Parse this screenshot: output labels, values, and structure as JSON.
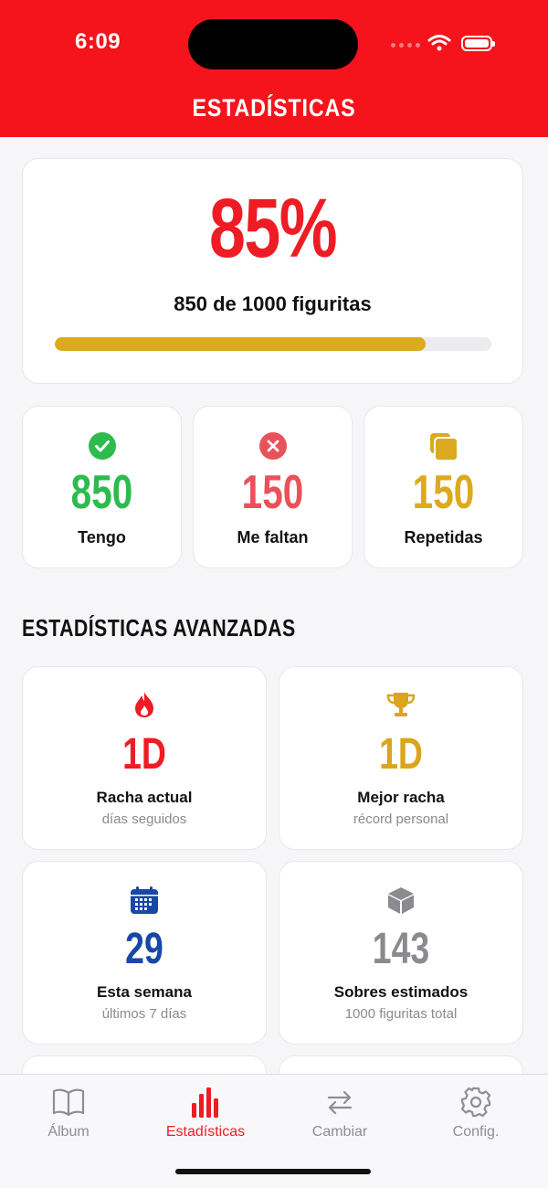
{
  "status_bar": {
    "time": "6:09"
  },
  "header": {
    "title": "ESTADÍSTICAS"
  },
  "progress": {
    "percent_label": "85%",
    "fraction": 0.85,
    "subtitle": "850 de 1000 figuritas"
  },
  "stats": [
    {
      "value": "850",
      "label": "Tengo",
      "color": "#2dbb4e",
      "icon": "check-circle-icon"
    },
    {
      "value": "150",
      "label": "Me faltan",
      "color": "#e9525a",
      "icon": "x-circle-icon"
    },
    {
      "value": "150",
      "label": "Repetidas",
      "color": "#dcaa1e",
      "icon": "duplicate-cards-icon"
    }
  ],
  "advanced": {
    "title": "ESTADÍSTICAS AVANZADAS",
    "items": [
      {
        "value": "1D",
        "label": "Racha actual",
        "sub": "días seguidos",
        "color": "#ee1c25",
        "icon": "flame-icon"
      },
      {
        "value": "1D",
        "label": "Mejor racha",
        "sub": "récord personal",
        "color": "#d9a61b",
        "icon": "trophy-icon"
      },
      {
        "value": "29",
        "label": "Esta semana",
        "sub": "últimos 7 días",
        "color": "#1847a6",
        "icon": "calendar-icon"
      },
      {
        "value": "143",
        "label": "Sobres estimados",
        "sub": "1000 figuritas total",
        "color": "#8a8a8f",
        "icon": "box-icon"
      }
    ]
  },
  "tabs": [
    {
      "label": "Álbum",
      "icon": "book-icon",
      "active": false
    },
    {
      "label": "Estadísticas",
      "icon": "bar-chart-icon",
      "active": true
    },
    {
      "label": "Cambiar",
      "icon": "swap-arrows-icon",
      "active": false
    },
    {
      "label": "Config.",
      "icon": "gear-icon",
      "active": false
    }
  ]
}
